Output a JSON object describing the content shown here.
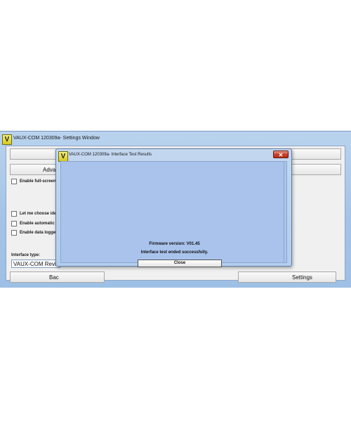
{
  "outer_window": {
    "title": "VAUX-COM 120309a- Settings Window",
    "logo_letter": "V",
    "top_button_label": "",
    "advanced_button_label": "Advanc",
    "checkboxes": [
      {
        "label": "Enable full-screen mo",
        "checked": false
      },
      {
        "label": "Let me choose identif",
        "checked": false
      },
      {
        "label": "Enable automatic DTC",
        "checked": false
      },
      {
        "label": "Enable data logger mo",
        "checked": false
      }
    ],
    "interface_type_label": "Interface type:",
    "interface_type_value": "VAUX-COM Revision",
    "back_button_label": "Bac",
    "settings_button_label": "Settings"
  },
  "dialog": {
    "title": "VAUX-COM 120309a- Interface Test Results",
    "logo_letter": "V",
    "close_icon": "✕",
    "firmware_text": "Firmware version: V01.45",
    "result_text": "Interface test ended successfully.",
    "close_button_label": "Close"
  },
  "colors": {
    "window_frame": "#a5c3e6",
    "dialog_client": "#a9c3ec",
    "close_red": "#c7432c"
  }
}
